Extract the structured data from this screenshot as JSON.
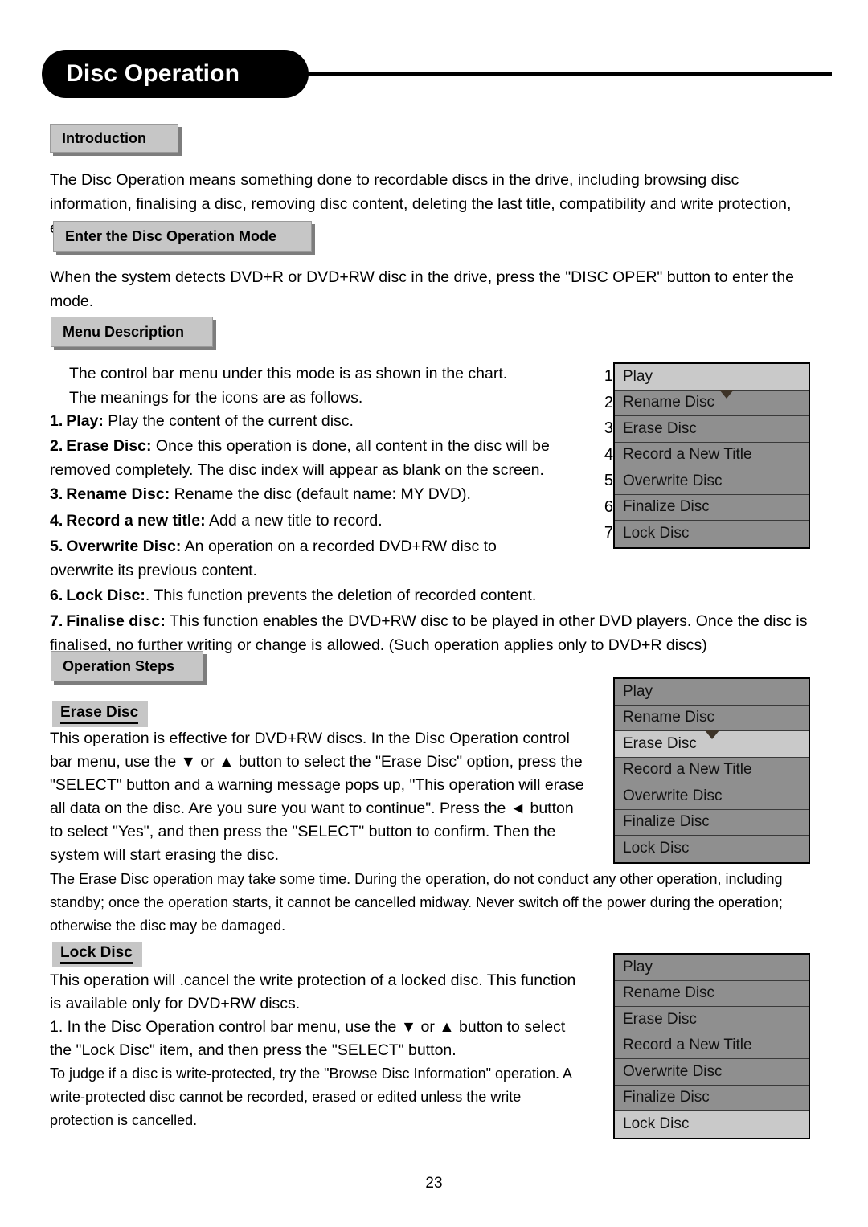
{
  "header": {
    "title": "Disc Operation"
  },
  "sections": {
    "introduction": {
      "tab_label": "Introduction",
      "paragraph": "The Disc Operation means something done to recordable discs in the drive, including browsing disc information, finalising a disc, removing disc content, deleting the last title, compatibility and write protection, etc."
    },
    "enter_mode": {
      "tab_label": "Enter the Disc Operation Mode",
      "paragraph": "When the system detects DVD+R or DVD+RW disc in the drive, press the \"DISC OPER\" button to enter the mode."
    },
    "menu_description": {
      "tab_label": "Menu Description",
      "intro_line1": "The control bar menu under this mode is as shown in the chart.",
      "intro_line2": "The meanings for the icons are as follows.",
      "items": [
        {
          "num": "1.",
          "term": "Play:",
          "text": " Play the content of the current disc."
        },
        {
          "num": "2.",
          "term": "Erase Disc:",
          "text": " Once this operation is done, all content in the disc will be removed completely. The disc index will appear as blank on the screen."
        },
        {
          "num": "3.",
          "term": "Rename Disc:",
          "text": " Rename the disc (default name: MY DVD)."
        },
        {
          "num": "4.",
          "term": "Record a new title:",
          "text": " Add a new title to record."
        },
        {
          "num": "5.",
          "term": "Overwrite Disc:",
          "text": " An operation on a recorded DVD+RW disc to overwrite its previous content."
        },
        {
          "num": "6.",
          "term": "Lock Disc:",
          "text": ". This function prevents the deletion of recorded content."
        },
        {
          "num": "7.",
          "term": "Finalise disc:",
          "text": " This function enables the DVD+RW disc to be played in other DVD players. Once the disc is finalised, no further writing or change is allowed. (Such operation applies only to DVD+R discs)"
        }
      ]
    },
    "operation_steps": {
      "tab_label": "Operation Steps",
      "erase_disc": {
        "subhead": "Erase Disc",
        "paragraph": "This operation is effective for DVD+RW discs. In the Disc Operation control bar menu, use the ▼ or ▲ button to select the \"Erase Disc\" option, press the \"SELECT\" button and a warning message pops up, \"This operation will erase all data on the disc. Are you sure you want to continue\". Press the ◄ button to select \"Yes\", and then press the \"SELECT\" button to confirm. Then the system will start erasing the disc.",
        "note": "The Erase Disc operation may take some time. During the operation, do not conduct any other operation, including standby; once the operation starts, it cannot be cancelled midway. Never switch off the power during the operation; otherwise the disc may be damaged."
      },
      "lock_disc": {
        "subhead": "Lock Disc",
        "paragraph": "This operation will .cancel the write protection of a locked disc. This function is available only for DVD+RW discs.",
        "step1": "1. In the Disc Operation control bar menu, use the ▼ or ▲ button to select the \"Lock Disc\" item, and then press the \"SELECT\" button.",
        "note": "To judge if a disc is write-protected, try the \"Browse Disc Information\" operation. A write-protected disc cannot be recorded, erased or edited unless the write protection is cancelled."
      }
    }
  },
  "menus": {
    "numbers": [
      "1",
      "2",
      "3",
      "4",
      "5",
      "6",
      "7"
    ],
    "items": [
      "Play",
      "Rename Disc",
      "Erase Disc",
      "Record a New Title",
      "Overwrite Disc",
      "Finalize Disc",
      "Lock Disc"
    ],
    "menu1": {
      "selected_index": 0,
      "cursor_index": 1,
      "numbered": true
    },
    "menu2": {
      "selected_index": 2,
      "cursor_index": 2,
      "numbered": false
    },
    "menu3": {
      "selected_index": 6,
      "cursor_index": -1,
      "numbered": false
    }
  },
  "colors": {
    "menu_row_bg": "#8f8f8f",
    "menu_row_selected_bg": "#c9c9c9",
    "tab_bg": "#c6c6c6",
    "tab_shadow": "#7d7d7d",
    "header_bg": "#000000",
    "header_text": "#ffffff"
  },
  "footer": {
    "page_number": "23"
  }
}
